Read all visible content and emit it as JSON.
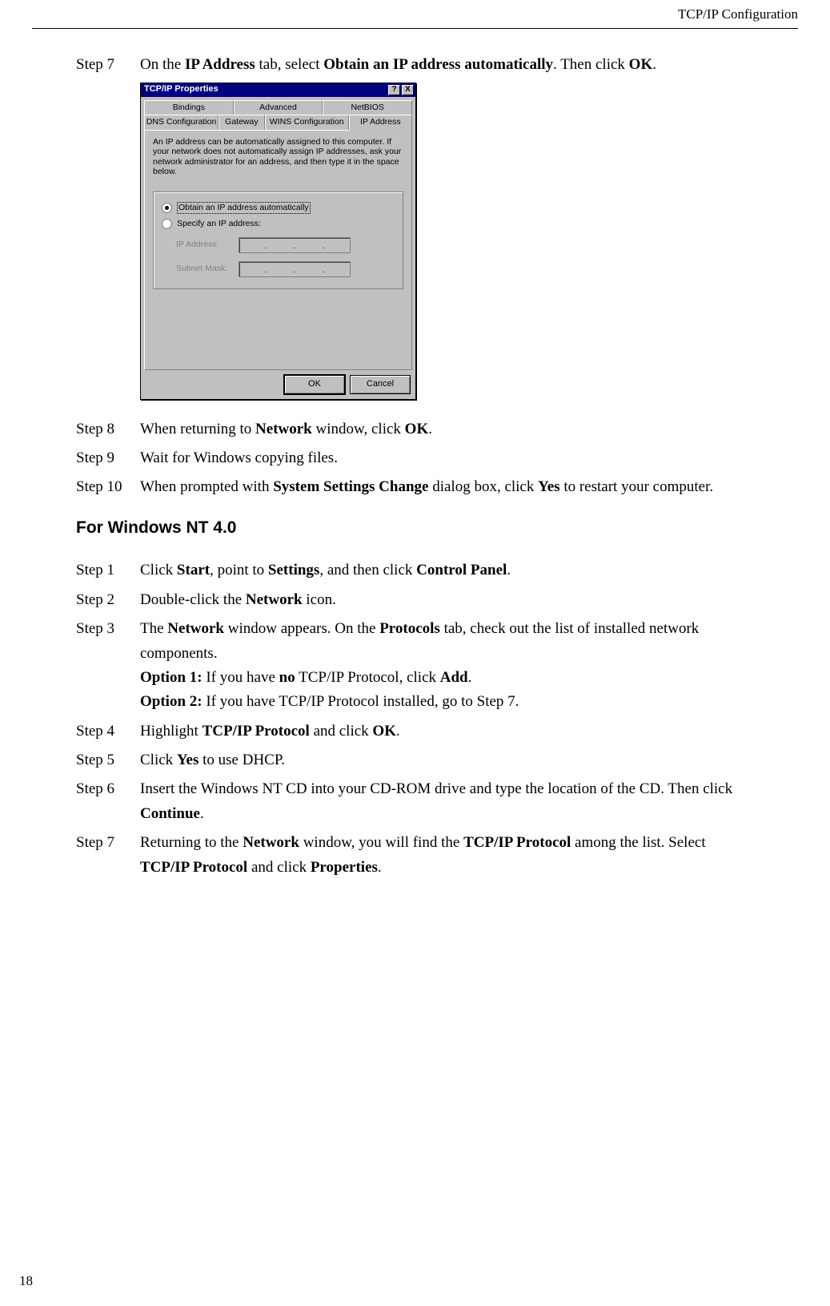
{
  "header": {
    "running_title": "TCP/IP Configuration"
  },
  "steps_a": [
    {
      "label": "Step 7",
      "parts": [
        "On the ",
        "IP Address",
        " tab, select ",
        "Obtain an IP address automatically",
        ". Then click ",
        "OK",
        "."
      ]
    },
    {
      "label": "Step 8",
      "parts": [
        "When returning to ",
        "Network",
        " window, click ",
        "OK",
        "."
      ]
    },
    {
      "label": "Step 9",
      "parts": [
        "Wait for Windows copying files."
      ]
    },
    {
      "label": "Step 10",
      "parts": [
        "When prompted with ",
        "System Settings Change",
        " dialog box, click ",
        "Yes",
        " to restart your computer."
      ]
    }
  ],
  "section_title": "For Windows NT 4.0",
  "steps_b": [
    {
      "label": "Step 1",
      "parts": [
        "Click ",
        "Start",
        ", point to ",
        "Settings",
        ", and then click ",
        "Control Panel",
        "."
      ]
    },
    {
      "label": "Step 2",
      "parts": [
        "Double-click the ",
        "Network",
        " icon."
      ]
    },
    {
      "label": "Step 3",
      "parts": [
        "The ",
        "Network",
        " window appears. On the ",
        "Protocols",
        " tab, check out the list of installed network components."
      ],
      "extra": [
        [
          "Option 1:",
          " If you have ",
          "no",
          " TCP/IP Protocol, click ",
          "Add",
          "."
        ],
        [
          "Option 2:",
          " If you have TCP/IP Protocol installed, go to Step 7."
        ]
      ]
    },
    {
      "label": "Step 4",
      "parts": [
        "Highlight ",
        "TCP/IP Protocol",
        " and click ",
        "OK",
        "."
      ]
    },
    {
      "label": "Step 5",
      "parts": [
        "Click ",
        "Yes",
        " to use DHCP."
      ]
    },
    {
      "label": "Step 6",
      "parts": [
        "Insert the Windows NT CD into your CD-ROM drive and type the location of the CD. Then click ",
        "Continue",
        "."
      ]
    },
    {
      "label": "Step 7",
      "parts": [
        "Returning to the ",
        "Network",
        " window, you will find the ",
        "TCP/IP Protocol",
        " among the list. Select ",
        "TCP/IP Protocol",
        " and click ",
        "Properties",
        "."
      ]
    }
  ],
  "dialog": {
    "title": "TCP/IP Properties",
    "help_glyph": "?",
    "close_glyph": "X",
    "tabs_top": [
      "Bindings",
      "Advanced",
      "NetBIOS"
    ],
    "tabs_bot": [
      "DNS Configuration",
      "Gateway",
      "WINS Configuration",
      "IP Address"
    ],
    "desc": "An IP address can be automatically assigned to this computer. If your network does not automatically assign IP addresses, ask your network administrator for an address, and then type it in the space below.",
    "opt_auto": "Obtain an IP address automatically",
    "opt_specify": "Specify an IP address:",
    "ip_label": "IP Address:",
    "mask_label": "Subnet Mask:",
    "ok": "OK",
    "cancel": "Cancel"
  },
  "page_number": "18"
}
